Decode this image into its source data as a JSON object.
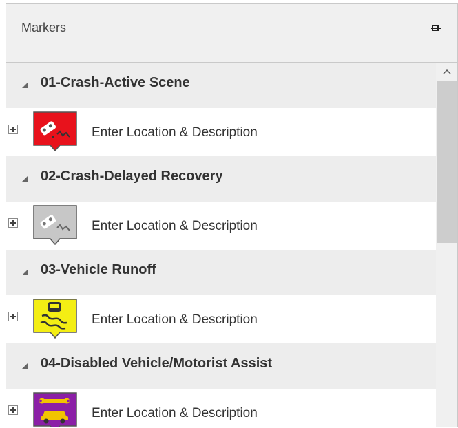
{
  "panel": {
    "title": "Markers",
    "pin_icon": "pin-icon"
  },
  "groups": [
    {
      "title": "01-Crash-Active Scene",
      "item_text": "Enter Location & Description",
      "icon": "crash-active-marker-icon",
      "color": "#e8121c"
    },
    {
      "title": "02-Crash-Delayed Recovery",
      "item_text": "Enter Location & Description",
      "icon": "crash-delayed-marker-icon",
      "color": "#c7c7c7"
    },
    {
      "title": "03-Vehicle Runoff",
      "item_text": "Enter Location & Description",
      "icon": "vehicle-runoff-marker-icon",
      "color": "#f4ee14"
    },
    {
      "title": "04-Disabled Vehicle/Motorist Assist",
      "item_text": "Enter Location & Description",
      "icon": "disabled-vehicle-marker-icon",
      "color": "#8b1fa6"
    }
  ]
}
